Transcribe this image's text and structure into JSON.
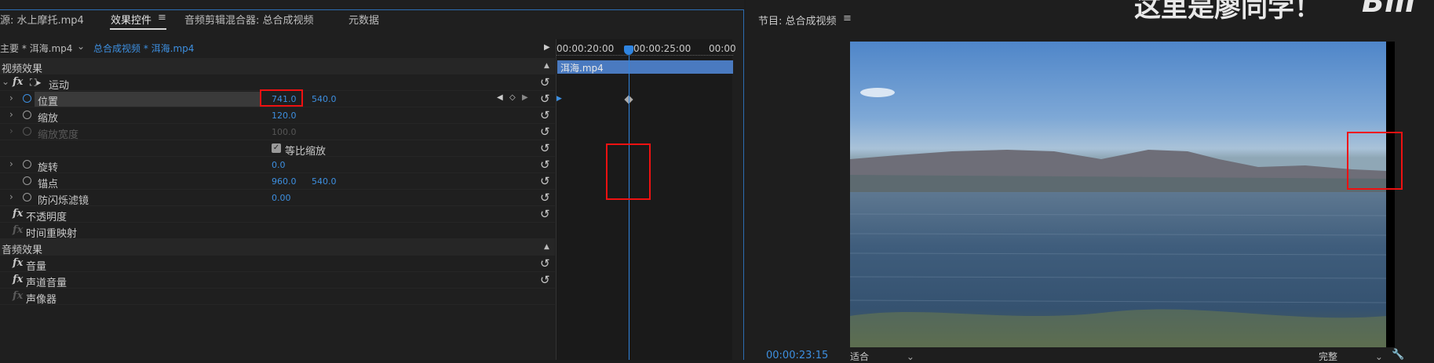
{
  "tabs": [
    {
      "label": "源: 水上摩托.mp4"
    },
    {
      "label": "效果控件"
    },
    {
      "label": "音频剪辑混合器: 总合成视频"
    },
    {
      "label": "元数据"
    }
  ],
  "master": {
    "main_label": "主要 * 洱海.mp4",
    "seq_label": "总合成视频 * 洱海.mp4"
  },
  "timecodes": {
    "t1": "00:00:20:00",
    "t2": "00:00:25:00",
    "t3": "00:00"
  },
  "clip_label": "洱海.mp4",
  "video_effects_header": "视频效果",
  "audio_effects_header": "音频效果",
  "motion": "运动",
  "properties": {
    "position": {
      "label": "位置",
      "x": "741.0",
      "y": "540.0"
    },
    "scale": {
      "label": "缩放",
      "value": "120.0"
    },
    "scale_width": {
      "label": "缩放宽度",
      "value": "100.0"
    },
    "uniform_scale": "等比缩放",
    "rotation": {
      "label": "旋转",
      "value": "0.0"
    },
    "anchor": {
      "label": "锚点",
      "x": "960.0",
      "y": "540.0"
    },
    "anti_flicker": {
      "label": "防闪烁滤镜",
      "value": "0.00"
    }
  },
  "opacity": "不透明度",
  "time_remap": "时间重映射",
  "audio": {
    "volume": "音量",
    "channel_volume": "声道音量",
    "panner": "声像器"
  },
  "program": {
    "title": "节目: 总合成视频",
    "timecode": "00:00:23:15",
    "fit": "适合",
    "quality": "完整"
  },
  "watermark": "这里是廖同学！",
  "logo_text": "Bili",
  "colors": {
    "accent": "#3d8fe0",
    "highlight_box": "#e11111"
  },
  "icons": [
    "menu-icon",
    "stopwatch-icon",
    "reset-icon",
    "keyframe-icon",
    "wrench-icon",
    "playhead-icon"
  ]
}
